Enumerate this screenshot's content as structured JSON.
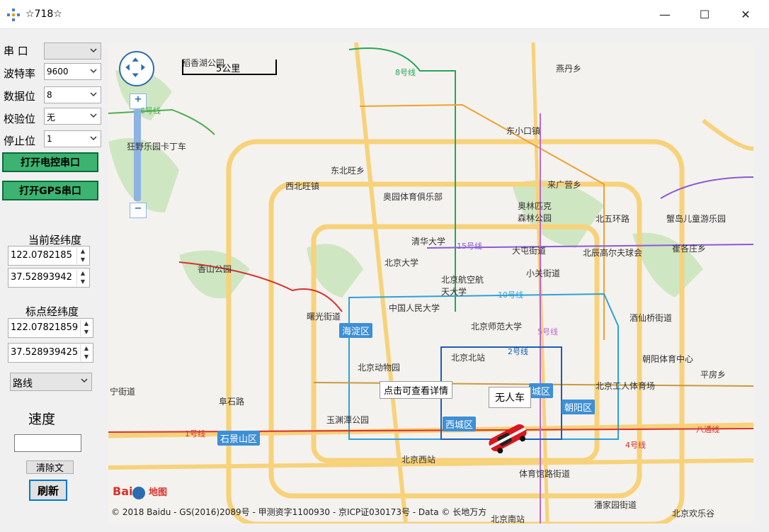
{
  "window": {
    "title": "☆718☆",
    "minimize": "—",
    "maximize": "☐",
    "close": "✕"
  },
  "serial": {
    "port_label": "串 口",
    "port_value": "",
    "baud_label": "波特率",
    "baud_value": "9600",
    "data_label": "数据位",
    "data_value": "8",
    "parity_label": "校验位",
    "parity_value": "无",
    "stop_label": "停止位",
    "stop_value": "1"
  },
  "buttons": {
    "open_control": "打开电控串口",
    "open_gps": "打开GPS串口",
    "clear": "清除文",
    "refresh": "刷新"
  },
  "current": {
    "label": "当前经纬度",
    "lng": "122.0782185",
    "lat": "37.52893942"
  },
  "target": {
    "label": "标点经纬度",
    "lng": "122.07821859",
    "lat": "37.528939425"
  },
  "mode": {
    "value": "路线"
  },
  "speed": {
    "label": "速度",
    "value": ""
  },
  "map": {
    "scale": "5公里",
    "zoom_in": "+",
    "zoom_out": "−",
    "labels": [
      {
        "text": "稻香湖公园"
      },
      {
        "text": "燕丹乡"
      },
      {
        "text": "东小口镇"
      },
      {
        "text": "东北旺乡"
      },
      {
        "text": "来广营乡"
      },
      {
        "text": "西北旺镇"
      },
      {
        "text": "奥园体育俱乐部"
      },
      {
        "text": "奥林匹克森林公园"
      },
      {
        "text": "北五环路"
      },
      {
        "text": "蟹岛儿童游乐园"
      },
      {
        "text": "清华大学"
      },
      {
        "text": "大屯街道"
      },
      {
        "text": "北辰高尔夫球会"
      },
      {
        "text": "崔各庄乡"
      },
      {
        "text": "香山公园"
      },
      {
        "text": "北京大学"
      },
      {
        "text": "北京航空航天大学"
      },
      {
        "text": "小关街道"
      },
      {
        "text": "中国人民大学"
      },
      {
        "text": "曙光街道"
      },
      {
        "text": "北京师范大学"
      },
      {
        "text": "酒仙桥街道"
      },
      {
        "text": "北京北站"
      },
      {
        "text": "朝阳体育中心"
      },
      {
        "text": "北京动物园"
      },
      {
        "text": "平房乡"
      },
      {
        "text": "北京工人体育场"
      },
      {
        "text": "宁街道"
      },
      {
        "text": "阜石路"
      },
      {
        "text": "玉渊潭公园"
      },
      {
        "text": "北京西站"
      },
      {
        "text": "体育馆路街道"
      },
      {
        "text": "潘家园街道"
      },
      {
        "text": "北京欢乐谷"
      },
      {
        "text": "北京南站"
      },
      {
        "text": "狂野乐园卡丁车"
      }
    ],
    "districts": [
      "海淀区",
      "西城区",
      "朝阳区",
      "石景山区",
      "城区"
    ],
    "lines": [
      {
        "text": "8号线"
      },
      {
        "text": "6号线"
      },
      {
        "text": "15号线"
      },
      {
        "text": "10号线"
      },
      {
        "text": "2号线"
      },
      {
        "text": "1号线"
      },
      {
        "text": "八通线"
      },
      {
        "text": "5号线"
      },
      {
        "text": "4号线"
      }
    ],
    "tooltip": "点击可查看详情",
    "marker": "无人车",
    "copyright": "© 2018 Baidu - GS(2016)2089号 - 甲测资字1100930 - 京ICP证030173号 - Data © 长地万方",
    "logo": "Bai百度地图"
  }
}
